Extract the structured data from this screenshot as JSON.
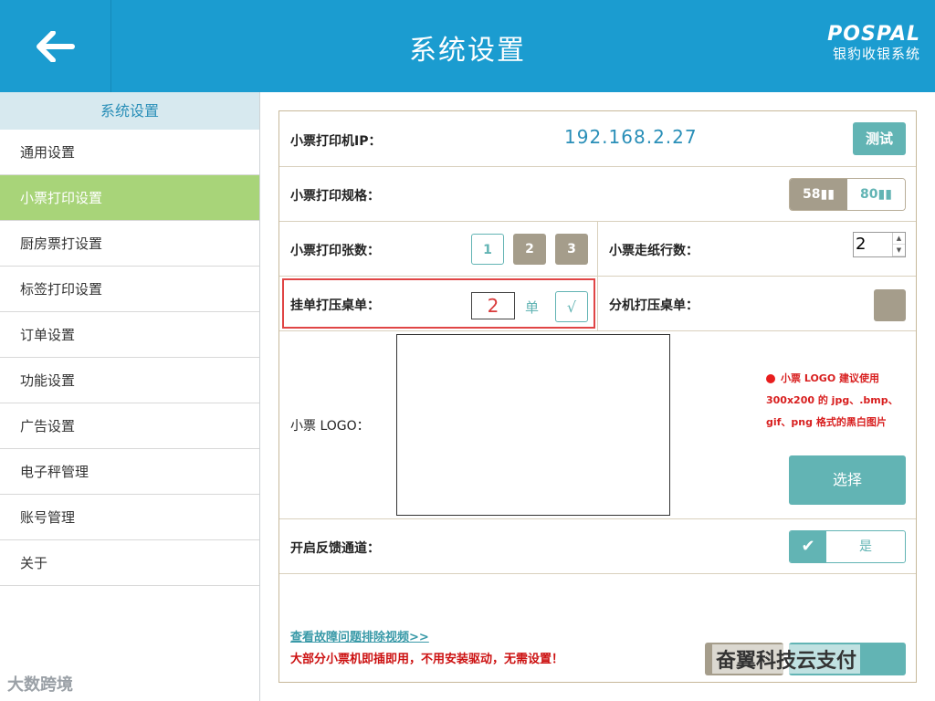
{
  "header": {
    "title": "系统设置",
    "brand_logo": "POSPAL",
    "brand_sub": "银豹收银系统"
  },
  "sidebar": {
    "heading": "系统设置",
    "items": [
      {
        "label": "通用设置"
      },
      {
        "label": "小票打印设置"
      },
      {
        "label": "厨房票打设置"
      },
      {
        "label": "标签打印设置"
      },
      {
        "label": "订单设置"
      },
      {
        "label": "功能设置"
      },
      {
        "label": "广告设置"
      },
      {
        "label": "电子秤管理"
      },
      {
        "label": "账号管理"
      },
      {
        "label": "关于"
      }
    ]
  },
  "main": {
    "printer_ip_label": "小票打印机IP：",
    "printer_ip_value": "192.168.2.27",
    "test_button": "测试",
    "spec_label": "小票打印规格：",
    "spec_options": [
      "58▮▮",
      "80▮▮"
    ],
    "copies_label": "小票打印张数：",
    "copies_options": [
      "1",
      "2",
      "3"
    ],
    "feed_label": "小票走纸行数：",
    "feed_value": "2",
    "hang_label": "挂单打压桌单：",
    "hang_qty": "2",
    "hang_unit": "单",
    "hang_check": "√",
    "split_label": "分机打压桌单：",
    "logo_label": "小票 LOGO：",
    "logo_note_1": "小票 LOGO 建议使用",
    "logo_note_2": "300x200 的 jpg、.bmp、",
    "logo_note_3": "gif、png 格式的黑白图片",
    "select_button": "选择",
    "feedback_label": "开启反馈通道：",
    "feedback_value": "是",
    "feedback_check": "✔",
    "video_link": "查看故障问题排除视频>>",
    "warning": "大部分小票机即插即用，不用安装驱动，无需设置！"
  },
  "watermarks": {
    "left": "大数跨境",
    "right": "奋翼科技云支付"
  },
  "colors": {
    "header": "#1b9cd0",
    "active_item": "#a8d479",
    "teal": "#62b4b4",
    "taupe": "#a59d8b",
    "red": "#d81f1f"
  }
}
